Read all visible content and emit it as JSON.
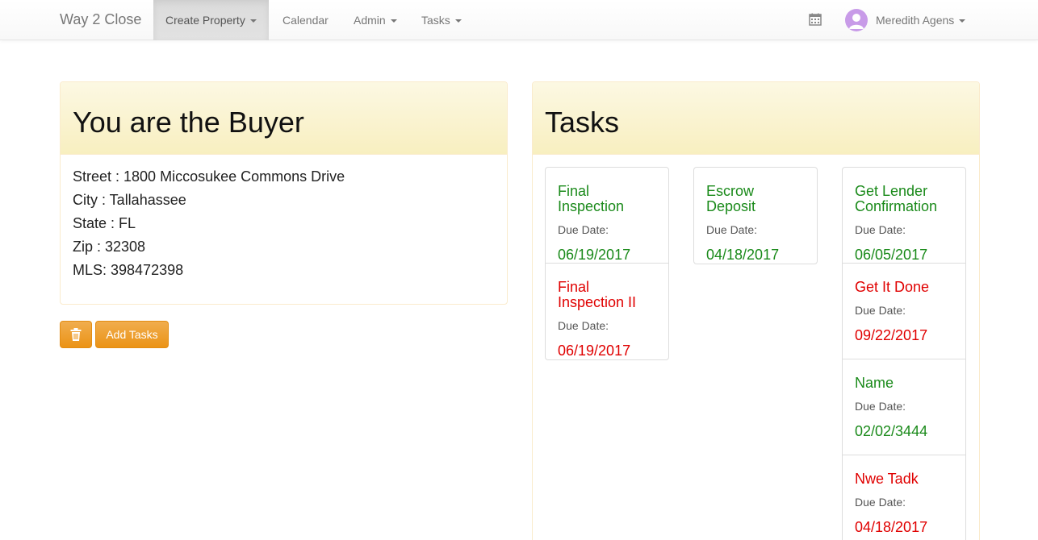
{
  "navbar": {
    "brand": "Way 2 Close",
    "items": [
      {
        "label": "Create Property"
      },
      {
        "label": "Calendar"
      },
      {
        "label": "Admin"
      },
      {
        "label": "Tasks"
      }
    ],
    "calendar_icon": "calendar-icon",
    "user": {
      "name": "Meredith Agens",
      "avatar_color": "#c89be8"
    }
  },
  "buyer_panel": {
    "title": "You are the Buyer",
    "lines": [
      "Street : 1800 Miccosukee Commons Drive",
      "City : Tallahassee",
      "State : FL",
      "Zip : 32308",
      "MLS: 398472398"
    ]
  },
  "buttons": {
    "delete_icon": "trash-icon",
    "add_tasks": "Add Tasks"
  },
  "tasks_panel": {
    "title": "Tasks",
    "due_label": "Due Date:",
    "columns": [
      [
        {
          "title": "Final Inspection",
          "date": "06/19/2017",
          "status": "green"
        },
        {
          "title": "Final Inspection II",
          "date": "06/19/2017",
          "status": "red"
        }
      ],
      [
        {
          "title": "Escrow Deposit",
          "date": "04/18/2017",
          "status": "green"
        }
      ],
      [
        {
          "title": "Get Lender Confirmation",
          "date": "06/05/2017",
          "status": "green"
        },
        {
          "title": "Get It Done",
          "date": "09/22/2017",
          "status": "red"
        },
        {
          "title": "Name",
          "date": "02/02/3444",
          "status": "green"
        },
        {
          "title": "Nwe Tadk",
          "date": "04/18/2017",
          "status": "red"
        }
      ]
    ]
  },
  "colors": {
    "green": "#1a8a1a",
    "red": "#e00000",
    "warning": "#f0ad4e"
  }
}
